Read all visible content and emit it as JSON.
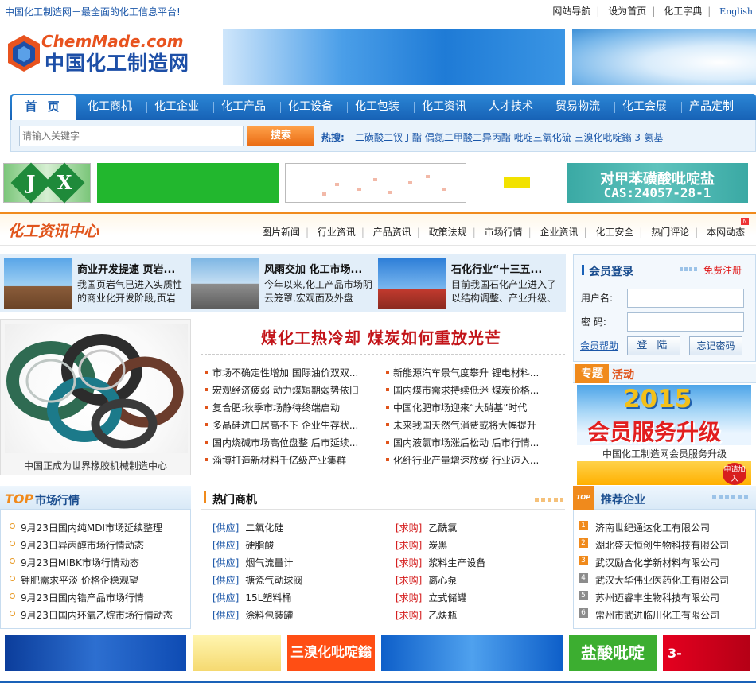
{
  "topbar": {
    "slogan": "中国化工制造网－最全面的化工信息平台!",
    "links": [
      "网站导航",
      "设为首页",
      "化工字典"
    ],
    "english": "English"
  },
  "header": {
    "logo_en": "ChemMade.com",
    "logo_cn": "中国化工制造网"
  },
  "nav": {
    "home": "首 页",
    "items": [
      "化工商机",
      "化工企业",
      "化工产品",
      "化工设备",
      "化工包装",
      "化工资讯",
      "人才技术",
      "贸易物流",
      "化工会展",
      "产品定制"
    ]
  },
  "search": {
    "placeholder": "请输入关键字",
    "button": "搜索",
    "hot_label": "热搜:",
    "hot_words": [
      "二磺酸二钗丁酯",
      "偶氮二甲酸二异丙酯",
      "吡啶三氧化硫",
      "三溴化吡啶鎓",
      "3-氨基"
    ]
  },
  "ads_top": {
    "jx_j": "J",
    "jx_x": "X",
    "cas_line1": "对甲苯磺酸吡啶盐",
    "cas_line2": "CAS:24057-28-1"
  },
  "news": {
    "title": "化工资讯中心",
    "tabs": [
      "图片新闻",
      "行业资讯",
      "产品资讯",
      "政策法规",
      "市场行情",
      "企业资讯",
      "化工安全",
      "热门评论",
      "本网动态"
    ],
    "new_badge": "N",
    "photo": [
      {
        "title": "商业开发提速 页岩...",
        "desc": "我国页岩气已进入实质性的商业化开发阶段,页岩"
      },
      {
        "title": "风雨交加 化工市场...",
        "desc": "今年以来,化工产品市场阴云笼罩,宏观面及外盘"
      },
      {
        "title": "石化行业“十三五...",
        "desc": "目前我国石化产业进入了以结构调整、产业升级、"
      }
    ],
    "image_caption": "中国正成为世界橡胶机械制造中心",
    "headline": "煤化工热冷却 煤炭如何重放光芒",
    "left_list": [
      "市场不确定性增加 国际油价双双...",
      "宏观经济疲弱 动力煤短期弱势依旧",
      "复合肥:秋季市场静待终端启动",
      "多晶硅进口居高不下 企业生存状...",
      "国内烧碱市场高位盘整 后市延续...",
      "淄博打造新材料千亿级产业集群"
    ],
    "right_list": [
      "新能源汽车景气度攀升 锂电材料...",
      "国内煤市需求持续低迷 煤炭价格...",
      "中国化肥市场迎来“大硝基”时代",
      "未来我国天然气消费或将大幅提升",
      "国内液氯市场涨后松动 后市行情...",
      "化纤行业产量增速放缓 行业迈入..."
    ]
  },
  "login": {
    "title": "会员登录",
    "register": "免费注册",
    "user_label": "用户名:",
    "pass_label": "密 码:",
    "help": "会员帮助",
    "login_btn": "登 陆",
    "forgot_btn": "忘记密码"
  },
  "topic": {
    "tab1": "专题",
    "tab2": "活动",
    "year": "2015",
    "service": "会员服务升级",
    "caption": "中国化工制造网会员服务升级",
    "badge": "申请加入"
  },
  "market": {
    "top": "TOP",
    "title": "市场行情",
    "items": [
      "9月23日国内纯MDI市场延续整理",
      "9月23日异丙醇市场行情动态",
      "9月23日MIBK市场行情动态",
      "钾肥需求平淡 价格企稳观望",
      "9月23日国内锆产品市场行情",
      "9月23日国内环氧乙烷市场行情动态"
    ]
  },
  "business": {
    "title": "热门商机",
    "supply_tag": "[供应]",
    "buy_tag": "[求购]",
    "supply": [
      "二氧化硅",
      "硬脂酸",
      "烟气流量计",
      "搪瓷气动球阀",
      "15L塑料桶",
      "涂料包装罐"
    ],
    "buy": [
      "乙酰氯",
      "炭黑",
      "浆料生产设备",
      "离心泵",
      "立式储罐",
      "乙炔瓶"
    ]
  },
  "recommend": {
    "tag": "TOP",
    "title": "推荐企业",
    "items": [
      "济南世纪通达化工有限公司",
      "湖北盛天恒创生物科技有限公司",
      "武汉励合化学新材料有限公司",
      "武汉大华伟业医药化工有限公司",
      "苏州迈睿丰生物科技有限公司",
      "常州市武进临川化工有限公司"
    ],
    "nums": [
      "1",
      "2",
      "3",
      "4",
      "5",
      "6"
    ]
  },
  "ads_bottom": {
    "ad3": "三溴化吡啶鎓",
    "ad5": "盐酸吡啶",
    "ad6": "3-"
  }
}
